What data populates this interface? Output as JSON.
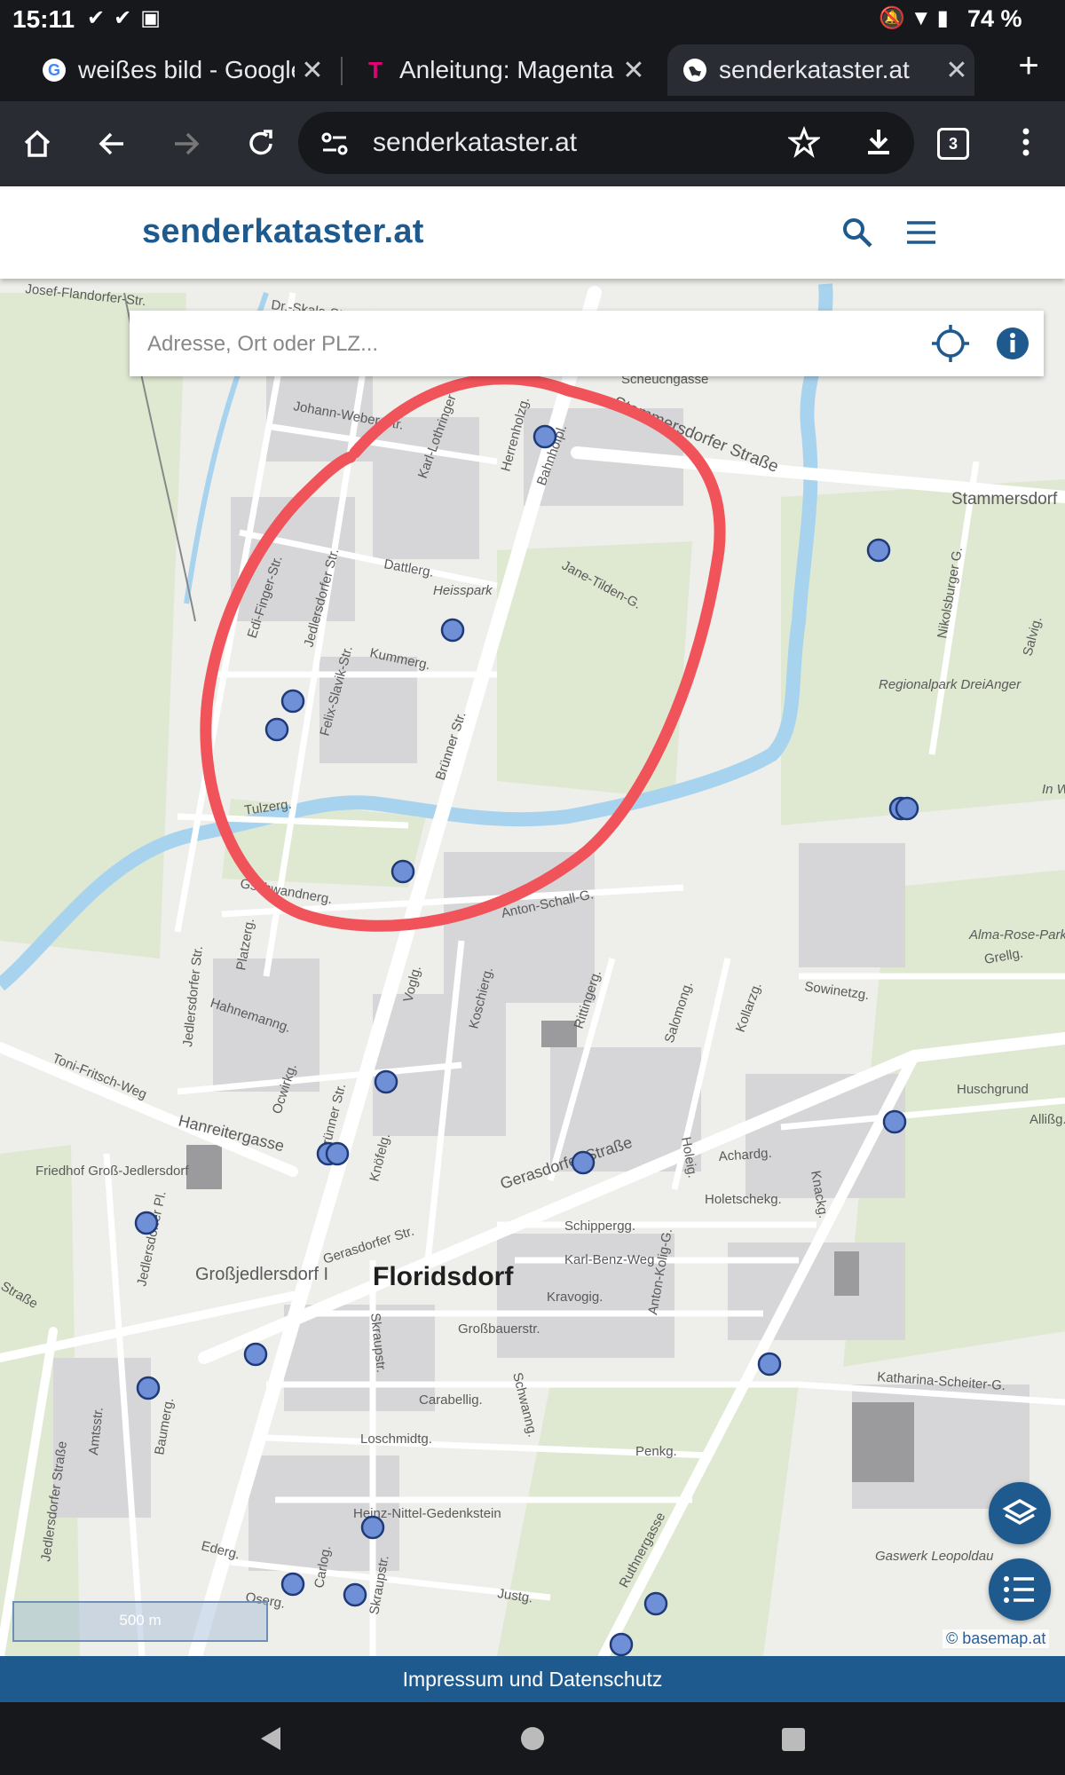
{
  "status_bar": {
    "time": "15:11",
    "battery": "74 %"
  },
  "browser": {
    "tabs": [
      {
        "label": "weißes bild - Google",
        "favicon": "G",
        "favicon_color": "#4285f4"
      },
      {
        "label": "Anleitung: Magenta",
        "favicon": "T",
        "favicon_color": "#e20074"
      },
      {
        "label": "senderkataster.at",
        "favicon": "globe",
        "favicon_color": "#ffffff",
        "active": true
      }
    ],
    "url": "senderkataster.at",
    "tab_count": "3"
  },
  "site": {
    "logo": "senderkataster.at",
    "brand_color": "#1e5a8e",
    "search_placeholder": "Adresse, Ort oder PLZ..."
  },
  "map": {
    "district_label": "Floridsdorf",
    "labels": [
      "Josef-Flandorfer-Str.",
      "Dr.-Skala-Str.",
      "Johann-Weber-Str.",
      "Karl-Lothringer",
      "Herrenholzg.",
      "Bahnhofpl.",
      "Scheuchgasse",
      "Stammersdorfer Straße",
      "Stammersdorf",
      "Dattlerg.",
      "Heisspark",
      "Jane-Tilden-G.",
      "Kummerg.",
      "Edi-Finger-Str.",
      "Jedlersdorfer Str.",
      "Felix-Slavik-Str.",
      "Brünner Str.",
      "Nikolsburger G.",
      "Regionalpark DreiAnger",
      "Salvig.",
      "In W",
      "Tulzerg.",
      "Gschwandnerg.",
      "Anton-Schall-G.",
      "Jedlersdorfer Str.",
      "Platzerg.",
      "Voglg.",
      "Koschierg.",
      "Rittingerg.",
      "Salomong.",
      "Kollarzg.",
      "Sowinetzg.",
      "Alma-Rose-Park",
      "Grellg.",
      "Hahnemanng.",
      "Ocwirkg.",
      "Brünner Str.",
      "Toni-Fritsch-Weg",
      "Hanreitergasse",
      "Knöfelg.",
      "Gerasdorfer Straße",
      "Achardg.",
      "Knackg.",
      "Huschgrund",
      "Allißg.",
      "Friedhof Groß-Jedlersdorf",
      "Jedlersdorfer Pl.",
      "Gerasdorfer Str.",
      "Holeig.",
      "Holetschekg.",
      "Schippergg.",
      "Karl-Benz-Weg",
      "Kravogig.",
      "Anton-Kolig-G.",
      "Großjedlersdorf I",
      "Großbauerstr.",
      "Skraupstr.",
      "Schwanng.",
      "Carabellig.",
      "Katharina-Scheiter-G.",
      "Loschmidtg.",
      "Penkg.",
      "Ruthnergasse",
      "Baumerg.",
      "Amtsstr.",
      "Jedlersdorfer Straße",
      "Heinz-Nittel-Gedenkstein",
      "Ederg.",
      "Carlog.",
      "Oserg.",
      "Skraupstr.",
      "Justg.",
      "Gaswerk Leopoldau",
      "Straße"
    ],
    "marker_count": 25,
    "scale_label": "500 m",
    "attribution": "© basemap.at"
  },
  "footer": {
    "link": "Impressum und Datenschutz"
  },
  "colors": {
    "marker": "#6f8fd6",
    "annotation_stroke": "#f0545a",
    "river": "#a8d3ee"
  }
}
